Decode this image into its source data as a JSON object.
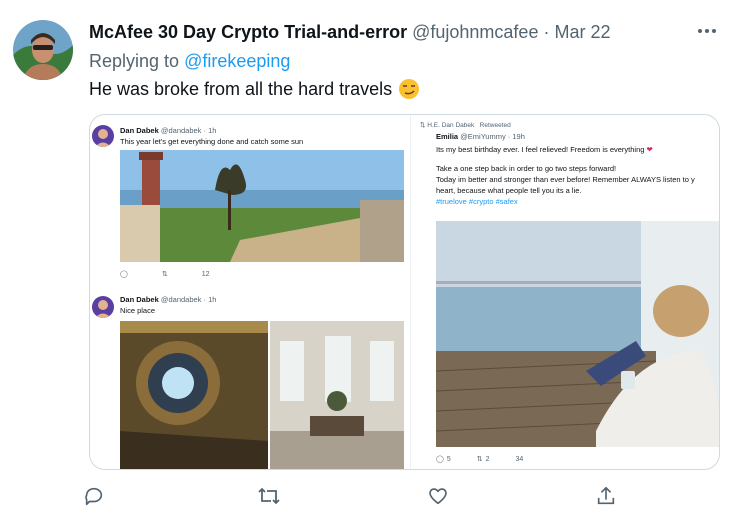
{
  "tweet": {
    "display_name": "McAfee 30 Day Crypto Trial-and-error",
    "handle": "@fujohnmcafee",
    "separator": "·",
    "date": "Mar 22",
    "more_label": "•••",
    "replying_prefix": "Replying to",
    "replying_handle": "@firekeeping",
    "text": "He was broke from all the hard travels"
  },
  "embedded": {
    "left_top": {
      "name": "Dan Dabek",
      "meta": "@dandabek · 1h",
      "text": "This year let's get everything done and catch some sun",
      "retweets": "",
      "likes": "12"
    },
    "left_bottom": {
      "name": "Dan Dabek",
      "meta": "@dandabek · 1h",
      "text": "Nice place"
    },
    "right": {
      "retweeted_by": "H.E. Dan Dabek",
      "retweeted_label": "Retweeted",
      "name": "Emilia",
      "meta": "@EmiYummy · 19h",
      "line1": "Its my best birthday ever. I feel relieved! Freedom is everything",
      "line2": "Take a one step back in order to go two steps forward!",
      "line3": "Today im better and stronger than ever before! Remember ALWAYS listen to y",
      "line4": "heart, because what people tell you its a lie.",
      "tags": "#truelove #crypto #safex",
      "replies": "5",
      "retweets": "2",
      "likes": "34"
    }
  },
  "actions": {
    "reply_icon": "speech-bubble-icon",
    "retweet_icon": "retweet-icon",
    "like_icon": "heart-icon",
    "share_icon": "share-icon"
  },
  "colors": {
    "accent": "#1d9bf0",
    "muted": "#536471",
    "border": "#cfd9de"
  }
}
